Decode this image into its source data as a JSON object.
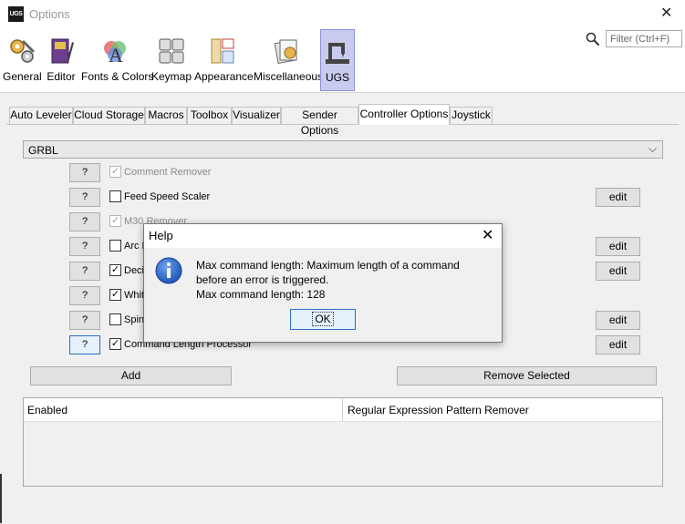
{
  "window": {
    "app_logo": "UGS",
    "title": "Options",
    "close": "✕"
  },
  "toolbar": {
    "items": [
      {
        "label": "General"
      },
      {
        "label": "Editor"
      },
      {
        "label": "Fonts & Colors"
      },
      {
        "label": "Keymap"
      },
      {
        "label": "Appearance"
      },
      {
        "label": "Miscellaneous"
      },
      {
        "label": "UGS"
      }
    ],
    "search_placeholder": "Filter (Ctrl+F)"
  },
  "tabs": [
    {
      "label": "Auto Leveler"
    },
    {
      "label": "Cloud Storage"
    },
    {
      "label": "Macros"
    },
    {
      "label": "Toolbox"
    },
    {
      "label": "Visualizer"
    },
    {
      "label": "Sender Options"
    },
    {
      "label": "Controller Options"
    },
    {
      "label": "Joystick"
    }
  ],
  "controller": {
    "firmware": "GRBL",
    "help_label": "?",
    "edit_label": "edit",
    "processors": [
      {
        "label": "Comment Remover",
        "checked": "✓"
      },
      {
        "label": "Feed Speed Scaler",
        "checked": ""
      },
      {
        "label": "M30 Remover",
        "checked": "✓"
      },
      {
        "label": "Arc E",
        "checked": ""
      },
      {
        "label": "Deci",
        "checked": "✓"
      },
      {
        "label": "Whit",
        "checked": "✓"
      },
      {
        "label": "Spin",
        "checked": ""
      },
      {
        "label": "Command Length Processor",
        "checked": "✓"
      }
    ],
    "add_label": "Add",
    "remove_label": "Remove Selected",
    "table": {
      "col_enabled": "Enabled",
      "col_pattern": "Regular Expression Pattern Remover"
    }
  },
  "help_dialog": {
    "title": "Help",
    "close": "✕",
    "line1": "Max command length: Maximum length of a command",
    "line2": "before an error is triggered.",
    "line3": "Max command length: 128",
    "ok_label": "OK"
  },
  "colors": {
    "ugs_selected_bg": "#c9cbee",
    "dialog_focus": "#2a6fc9",
    "info_icon": "#1e56b8"
  }
}
